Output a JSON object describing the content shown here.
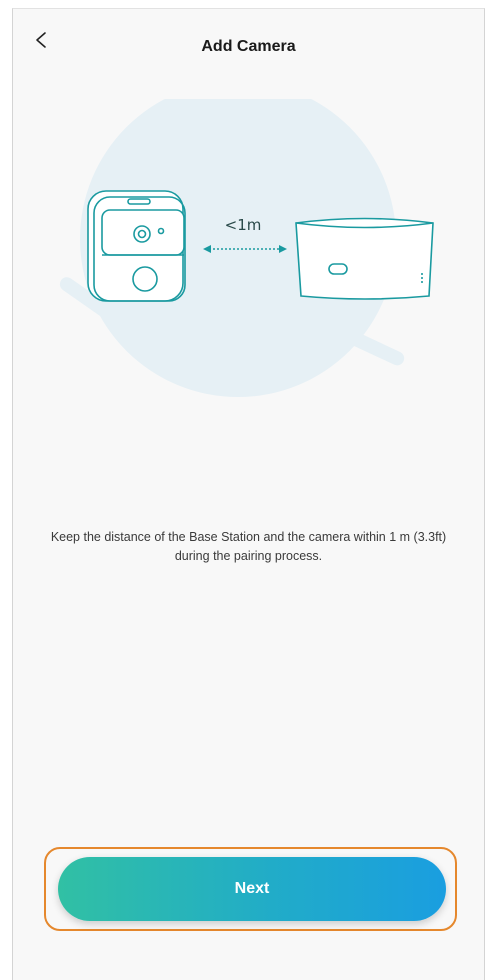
{
  "header": {
    "title": "Add Camera",
    "back_icon": "chevron-left-icon"
  },
  "illustration": {
    "distance_label": "<1m",
    "accent_color": "#1a9aa0",
    "background_circle_color": "#e6f0f5"
  },
  "instruction": {
    "text": "Keep the distance of the Base Station and the camera within 1 m (3.3ft) during the pairing process."
  },
  "footer": {
    "next_label": "Next",
    "button_gradient": [
      "#31c0a4",
      "#1a9ee0"
    ],
    "highlight_color": "#e5882d"
  }
}
